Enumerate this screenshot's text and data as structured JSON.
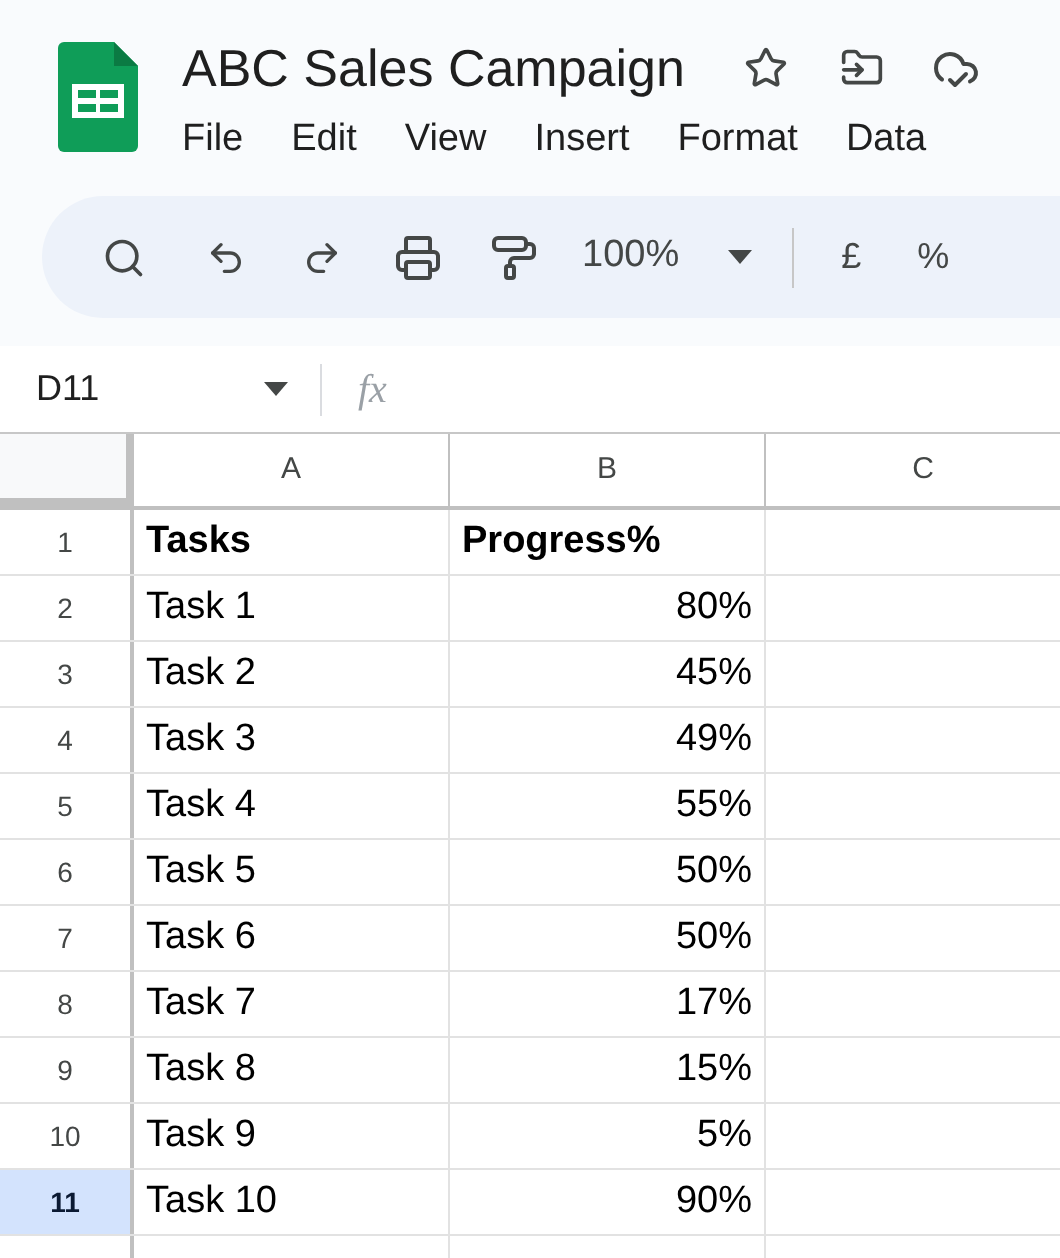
{
  "document": {
    "title": "ABC Sales Campaign"
  },
  "menu": [
    "File",
    "Edit",
    "View",
    "Insert",
    "Format",
    "Data"
  ],
  "toolbar": {
    "zoom": "100%",
    "currency": "£",
    "percent": "%"
  },
  "formula_bar": {
    "cell_ref": "D11",
    "fx": "fx"
  },
  "columns": [
    "A",
    "B",
    "C"
  ],
  "rows": [
    {
      "number": "1",
      "selected": false,
      "cells": [
        "Tasks",
        "Progress%"
      ],
      "header": true
    },
    {
      "number": "2",
      "selected": false,
      "cells": [
        "Task 1",
        "80%"
      ],
      "header": false
    },
    {
      "number": "3",
      "selected": false,
      "cells": [
        "Task 2",
        "45%"
      ],
      "header": false
    },
    {
      "number": "4",
      "selected": false,
      "cells": [
        "Task 3",
        "49%"
      ],
      "header": false
    },
    {
      "number": "5",
      "selected": false,
      "cells": [
        "Task 4",
        "55%"
      ],
      "header": false
    },
    {
      "number": "6",
      "selected": false,
      "cells": [
        "Task 5",
        "50%"
      ],
      "header": false
    },
    {
      "number": "7",
      "selected": false,
      "cells": [
        "Task 6",
        "50%"
      ],
      "header": false
    },
    {
      "number": "8",
      "selected": false,
      "cells": [
        "Task 7",
        "17%"
      ],
      "header": false
    },
    {
      "number": "9",
      "selected": false,
      "cells": [
        "Task 8",
        "15%"
      ],
      "header": false
    },
    {
      "number": "10",
      "selected": false,
      "cells": [
        "Task 9",
        "5%"
      ],
      "header": false
    },
    {
      "number": "11",
      "selected": true,
      "cells": [
        "Task 10",
        "90%"
      ],
      "header": false
    }
  ]
}
